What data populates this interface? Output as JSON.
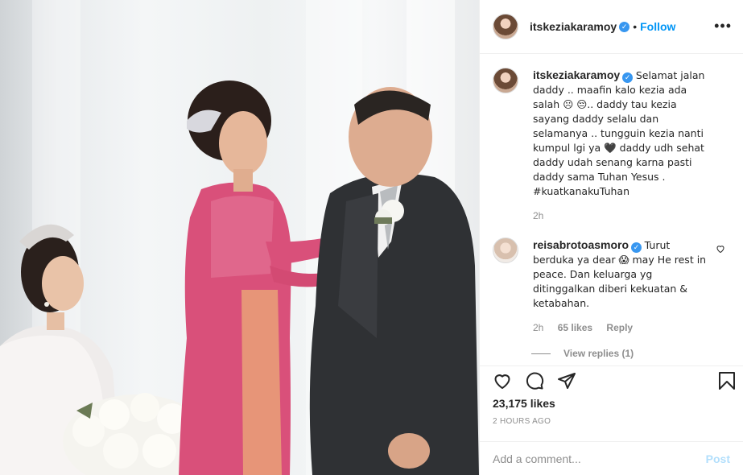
{
  "post": {
    "username": "itskeziakaramoy",
    "separator": "•",
    "follow_label": "Follow",
    "more_icon": "more-horizontal-icon"
  },
  "caption": {
    "username": "itskeziakaramoy",
    "text": "Selamat jalan daddy .. maafin kalo kezia ada salah ☹ 😔.. daddy tau kezia sayang daddy selalu dan selamanya .. tungguin kezia nanti kumpul lgi ya 🖤 daddy udh sehat daddy udah senang karna pasti daddy sama Tuhan Yesus . ",
    "hashtag": "#kuatkanakuTuhan",
    "time": "2h"
  },
  "comments": [
    {
      "username": "reisabrotoasmoro",
      "text": "Turut berduka ya dear 😱 may He rest in peace. Dan keluarga yg ditinggalkan diberi kekuatan & ketabahan.",
      "time": "2h",
      "likes": "65 likes",
      "reply_label": "Reply",
      "view_replies": "View replies (1)"
    }
  ],
  "actions": {
    "like_icon": "heart-icon",
    "comment_icon": "comment-icon",
    "share_icon": "paper-plane-icon",
    "save_icon": "bookmark-icon"
  },
  "stats": {
    "likes": "23,175 likes",
    "posted": "2 HOURS AGO"
  },
  "composer": {
    "placeholder": "Add a comment...",
    "post_label": "Post"
  },
  "colors": {
    "link": "#0095f6",
    "verified": "#3897f0",
    "post_disabled": "#b2dffc"
  }
}
